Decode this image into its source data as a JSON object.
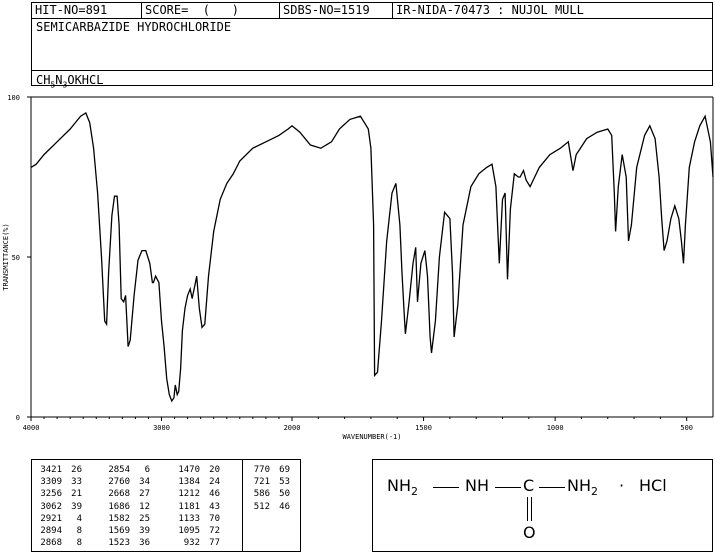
{
  "header": {
    "hit_no": "HIT-NO=891",
    "score": "SCORE=  (   )",
    "sdbs_no": "SDBS-NO=1519",
    "source": "IR-NIDA-70473 : NUJOL MULL",
    "compound_name": "SEMICARBAZIDE HYDROCHLORIDE",
    "formula": {
      "c": "CH",
      "n1": "5",
      "n": "N",
      "n2": "3",
      "rest": "OKHCL"
    }
  },
  "chart_data": {
    "type": "line",
    "xlabel": "WAVENUMBER(-1)",
    "ylabel": "TRANSMITTANCE(%)",
    "xlim": [
      4000,
      400
    ],
    "ylim": [
      0,
      100
    ],
    "x_ticks": [
      4000,
      3000,
      2000,
      1500,
      1000,
      500
    ],
    "y_ticks": [
      0,
      50,
      100
    ],
    "x_tick_labels": [
      "4000",
      "3000",
      "2000",
      "1500",
      "1000",
      "500"
    ],
    "y_tick_labels": [
      "0",
      "50",
      "100"
    ],
    "grid": false,
    "series": [
      {
        "points": [
          [
            4000,
            78
          ],
          [
            3960,
            79
          ],
          [
            3900,
            82
          ],
          [
            3800,
            86
          ],
          [
            3700,
            90
          ],
          [
            3620,
            94
          ],
          [
            3580,
            95
          ],
          [
            3550,
            92
          ],
          [
            3520,
            84
          ],
          [
            3490,
            70
          ],
          [
            3460,
            50
          ],
          [
            3435,
            30
          ],
          [
            3421,
            29
          ],
          [
            3405,
            45
          ],
          [
            3380,
            63
          ],
          [
            3360,
            69
          ],
          [
            3340,
            69
          ],
          [
            3325,
            60
          ],
          [
            3309,
            37
          ],
          [
            3290,
            36
          ],
          [
            3275,
            38
          ],
          [
            3256,
            22
          ],
          [
            3240,
            24
          ],
          [
            3210,
            38
          ],
          [
            3180,
            49
          ],
          [
            3150,
            52
          ],
          [
            3120,
            52
          ],
          [
            3090,
            48
          ],
          [
            3070,
            42
          ],
          [
            3062,
            42
          ],
          [
            3045,
            44
          ],
          [
            3020,
            42
          ],
          [
            3000,
            30
          ],
          [
            2980,
            22
          ],
          [
            2960,
            12
          ],
          [
            2940,
            7
          ],
          [
            2921,
            5
          ],
          [
            2905,
            6
          ],
          [
            2894,
            10
          ],
          [
            2880,
            7
          ],
          [
            2868,
            8
          ],
          [
            2854,
            15
          ],
          [
            2840,
            27
          ],
          [
            2820,
            34
          ],
          [
            2800,
            38
          ],
          [
            2780,
            40
          ],
          [
            2765,
            37
          ],
          [
            2760,
            38
          ],
          [
            2745,
            41
          ],
          [
            2730,
            44
          ],
          [
            2710,
            34
          ],
          [
            2690,
            28
          ],
          [
            2668,
            29
          ],
          [
            2640,
            44
          ],
          [
            2600,
            58
          ],
          [
            2550,
            68
          ],
          [
            2500,
            73
          ],
          [
            2450,
            76
          ],
          [
            2400,
            80
          ],
          [
            2300,
            84
          ],
          [
            2200,
            86
          ],
          [
            2100,
            88
          ],
          [
            2030,
            90
          ],
          [
            2000,
            91
          ],
          [
            1970,
            89
          ],
          [
            1930,
            85
          ],
          [
            1890,
            84
          ],
          [
            1850,
            86
          ],
          [
            1820,
            90
          ],
          [
            1780,
            93
          ],
          [
            1740,
            94
          ],
          [
            1710,
            90
          ],
          [
            1700,
            84
          ],
          [
            1690,
            60
          ],
          [
            1686,
            13
          ],
          [
            1675,
            14
          ],
          [
            1660,
            30
          ],
          [
            1640,
            55
          ],
          [
            1620,
            70
          ],
          [
            1605,
            73
          ],
          [
            1590,
            60
          ],
          [
            1582,
            45
          ],
          [
            1572,
            30
          ],
          [
            1569,
            26
          ],
          [
            1555,
            36
          ],
          [
            1540,
            48
          ],
          [
            1530,
            53
          ],
          [
            1523,
            36
          ],
          [
            1510,
            48
          ],
          [
            1495,
            52
          ],
          [
            1485,
            44
          ],
          [
            1475,
            25
          ],
          [
            1470,
            20
          ],
          [
            1455,
            30
          ],
          [
            1440,
            50
          ],
          [
            1420,
            64
          ],
          [
            1400,
            62
          ],
          [
            1390,
            45
          ],
          [
            1384,
            25
          ],
          [
            1370,
            35
          ],
          [
            1350,
            60
          ],
          [
            1320,
            72
          ],
          [
            1290,
            76
          ],
          [
            1260,
            78
          ],
          [
            1240,
            79
          ],
          [
            1225,
            72
          ],
          [
            1212,
            48
          ],
          [
            1200,
            68
          ],
          [
            1190,
            70
          ],
          [
            1181,
            43
          ],
          [
            1170,
            65
          ],
          [
            1155,
            76
          ],
          [
            1140,
            75
          ],
          [
            1133,
            75
          ],
          [
            1120,
            77
          ],
          [
            1110,
            74
          ],
          [
            1095,
            72
          ],
          [
            1060,
            78
          ],
          [
            1020,
            82
          ],
          [
            980,
            84
          ],
          [
            950,
            86
          ],
          [
            932,
            77
          ],
          [
            920,
            82
          ],
          [
            880,
            87
          ],
          [
            840,
            89
          ],
          [
            800,
            90
          ],
          [
            785,
            88
          ],
          [
            775,
            70
          ],
          [
            770,
            58
          ],
          [
            760,
            72
          ],
          [
            745,
            82
          ],
          [
            730,
            75
          ],
          [
            721,
            55
          ],
          [
            710,
            60
          ],
          [
            690,
            78
          ],
          [
            660,
            88
          ],
          [
            640,
            91
          ],
          [
            620,
            87
          ],
          [
            605,
            75
          ],
          [
            595,
            62
          ],
          [
            586,
            52
          ],
          [
            575,
            55
          ],
          [
            560,
            62
          ],
          [
            545,
            66
          ],
          [
            530,
            62
          ],
          [
            520,
            55
          ],
          [
            512,
            48
          ],
          [
            505,
            60
          ],
          [
            490,
            78
          ],
          [
            470,
            86
          ],
          [
            450,
            91
          ],
          [
            430,
            94
          ],
          [
            410,
            86
          ],
          [
            400,
            75
          ]
        ]
      }
    ]
  },
  "peak_table": {
    "columns": [
      [
        [
          "3421",
          "26"
        ],
        [
          "3309",
          "33"
        ],
        [
          "3256",
          "21"
        ],
        [
          "3062",
          "39"
        ],
        [
          "2921",
          "4"
        ],
        [
          "2894",
          "8"
        ],
        [
          "2868",
          "8"
        ]
      ],
      [
        [
          "2854",
          "6"
        ],
        [
          "2760",
          "34"
        ],
        [
          "2668",
          "27"
        ],
        [
          "1686",
          "12"
        ],
        [
          "1582",
          "25"
        ],
        [
          "1569",
          "39"
        ],
        [
          "1523",
          "36"
        ]
      ],
      [
        [
          "1470",
          "20"
        ],
        [
          "1384",
          "24"
        ],
        [
          "1212",
          "46"
        ],
        [
          "1181",
          "43"
        ],
        [
          "1133",
          "70"
        ],
        [
          "1095",
          "72"
        ],
        [
          "932",
          "77"
        ]
      ],
      [
        [
          "770",
          "69"
        ],
        [
          "721",
          "53"
        ],
        [
          "586",
          "50"
        ],
        [
          "512",
          "46"
        ]
      ]
    ]
  },
  "structure": {
    "nh2_left": "NH",
    "sub2": "2",
    "nh": "NH",
    "c": "C",
    "nh2_right": "NH",
    "dot": "·",
    "hcl": "HCl",
    "o": "O"
  }
}
